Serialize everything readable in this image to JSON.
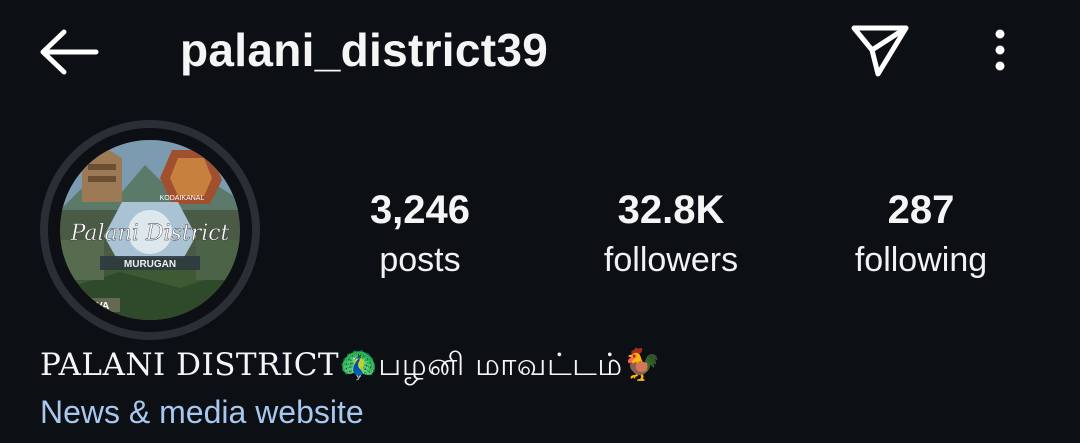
{
  "header": {
    "username": "palani_district39",
    "back_icon": "back-arrow-icon",
    "send_icon": "paper-plane-icon",
    "more_icon": "vertical-dots-icon"
  },
  "profile": {
    "avatar_script_text": "Palani District",
    "avatar_banner_text": "MURUGAN",
    "avatar_top_text": "KODAIKANAL",
    "avatar_bottom_text": "MARAVA"
  },
  "stats": [
    {
      "value": "3,246",
      "label": "posts"
    },
    {
      "value": "32.8K",
      "label": "followers"
    },
    {
      "value": "287",
      "label": "following"
    }
  ],
  "bio": {
    "display_name": "PALANI DISTRICT🦚பழனி மாவட்டம்🐓",
    "category": "News & media website"
  },
  "colors": {
    "background": "#0c0f14",
    "text": "#f5f5f5",
    "category_link": "#a8c7ee",
    "avatar_ring": "#2a2e35"
  }
}
